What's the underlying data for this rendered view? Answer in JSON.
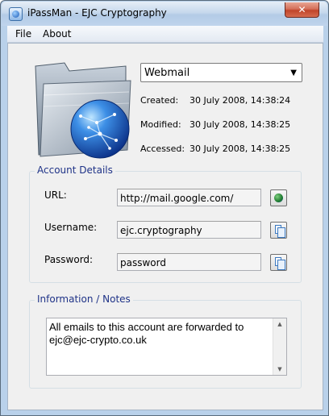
{
  "window": {
    "title": "iPassMan - EJC Cryptography",
    "close_glyph": "✕"
  },
  "menu": {
    "items": [
      "File",
      "About"
    ]
  },
  "account_select": {
    "selected": "Webmail",
    "arrow": "▼"
  },
  "meta": {
    "created_label": "Created:",
    "created_value": "30 July 2008, 14:38:24",
    "modified_label": "Modified:",
    "modified_value": "30 July 2008, 14:38:25",
    "accessed_label": "Accessed:",
    "accessed_value": "30 July 2008, 14:38:25"
  },
  "account_details": {
    "title": "Account Details",
    "url_label": "URL:",
    "url_value": "http://mail.google.com/",
    "username_label": "Username:",
    "username_value": "ejc.cryptography",
    "password_label": "Password:",
    "password_value": "password"
  },
  "notes": {
    "title": "Information / Notes",
    "text": "All emails to this account are forwarded to ejc@ejc-crypto.co.uk",
    "scroll_up": "▲",
    "scroll_down": "▼"
  },
  "icons": {
    "app": "app-icon",
    "folder": "folder-globe-icon",
    "open_url": "globe-icon",
    "copy": "copy-icon"
  }
}
